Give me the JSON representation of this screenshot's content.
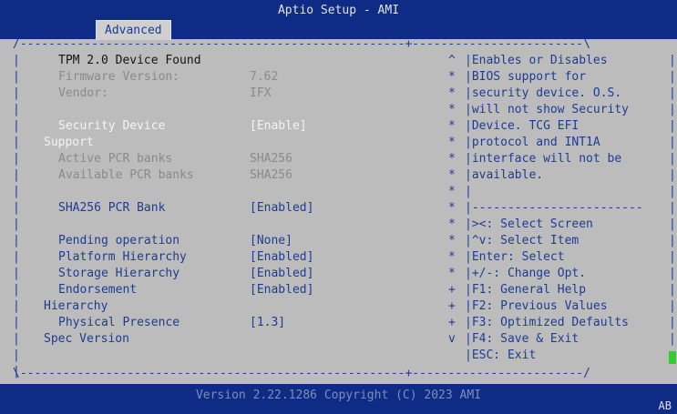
{
  "header": {
    "title": "Aptio Setup - AMI",
    "tab": "Advanced"
  },
  "settings": [
    {
      "label": "TPM 2.0 Device Found",
      "value": "",
      "style": "dark",
      "indent": 1
    },
    {
      "label": "Firmware Version:",
      "value": "7.62",
      "style": "gray",
      "indent": 1
    },
    {
      "label": "Vendor:",
      "value": "IFX",
      "style": "gray",
      "indent": 1
    },
    {
      "label": "",
      "value": "",
      "style": "gray",
      "indent": 1
    },
    {
      "label": "Security Device",
      "value": "[Enable]",
      "style": "white",
      "indent": 1
    },
    {
      "label": "Support",
      "value": "",
      "style": "white",
      "indent": 0
    },
    {
      "label": "Active PCR banks",
      "value": "SHA256",
      "style": "gray",
      "indent": 1
    },
    {
      "label": "Available PCR banks",
      "value": "SHA256",
      "style": "gray",
      "indent": 1
    },
    {
      "label": "",
      "value": "",
      "style": "gray",
      "indent": 1
    },
    {
      "label": "SHA256 PCR Bank",
      "value": "[Enabled]",
      "style": "blue",
      "indent": 1
    },
    {
      "label": "",
      "value": "",
      "style": "gray",
      "indent": 1
    },
    {
      "label": "Pending operation",
      "value": "[None]",
      "style": "blue",
      "indent": 1
    },
    {
      "label": "Platform Hierarchy",
      "value": "[Enabled]",
      "style": "blue",
      "indent": 1
    },
    {
      "label": "Storage Hierarchy",
      "value": "[Enabled]",
      "style": "blue",
      "indent": 1
    },
    {
      "label": "Endorsement",
      "value": "[Enabled]",
      "style": "blue",
      "indent": 1
    },
    {
      "label": "Hierarchy",
      "value": "",
      "style": "blue",
      "indent": 0
    },
    {
      "label": "Physical Presence",
      "value": "[1.3]",
      "style": "blue",
      "indent": 1
    },
    {
      "label": "Spec Version",
      "value": "",
      "style": "blue",
      "indent": 0
    }
  ],
  "help": [
    {
      "mark": "^",
      "text": "|Enables or Disables"
    },
    {
      "mark": "*",
      "text": "|BIOS support for"
    },
    {
      "mark": "*",
      "text": "|security device. O.S."
    },
    {
      "mark": "*",
      "text": "|will not show Security"
    },
    {
      "mark": "*",
      "text": "|Device. TCG EFI"
    },
    {
      "mark": "*",
      "text": "|protocol and INT1A"
    },
    {
      "mark": "*",
      "text": "|interface will not be"
    },
    {
      "mark": "*",
      "text": "|available."
    },
    {
      "mark": "*",
      "text": "|"
    },
    {
      "mark": "*",
      "text": "|------------------------"
    },
    {
      "mark": "*",
      "text": "|><: Select Screen"
    },
    {
      "mark": "*",
      "text": "|^v: Select Item"
    },
    {
      "mark": "*",
      "text": "|Enter: Select"
    },
    {
      "mark": "*",
      "text": "|+/-: Change Opt."
    },
    {
      "mark": "+",
      "text": "|F1: General Help"
    },
    {
      "mark": "+",
      "text": "|F2: Previous Values"
    },
    {
      "mark": "+",
      "text": "|F3: Optimized Defaults"
    },
    {
      "mark": "v",
      "text": "|F4: Save & Exit"
    },
    {
      "mark": "",
      "text": "|ESC: Exit"
    }
  ],
  "footer": {
    "copyright": "Version 2.22.1286 Copyright (C) 2023 AMI",
    "badge": "AB"
  }
}
